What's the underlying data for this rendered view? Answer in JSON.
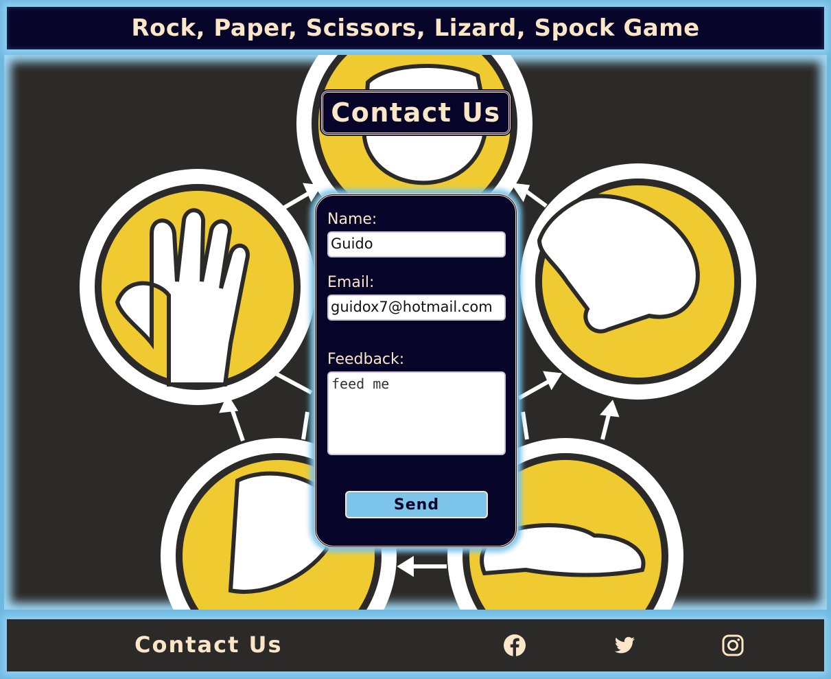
{
  "header": {
    "title": "Rock, Paper, Scissors, Lizard, Spock Game"
  },
  "main": {
    "heading": "Contact Us",
    "form": {
      "name_label": "Name:",
      "name_value": "Guido",
      "email_label": "Email:",
      "email_value": "guidox7@hotmail.com",
      "feedback_label": "Feedback:",
      "feedback_value": "feed me",
      "send_label": "Send"
    }
  },
  "footer": {
    "link": "Contact Us",
    "social": [
      {
        "icon": "facebook-icon"
      },
      {
        "icon": "twitter-icon"
      },
      {
        "icon": "instagram-icon"
      }
    ]
  },
  "colors": {
    "navy": "#07042a",
    "cream": "#fbe6c8",
    "sky": "#7cc4ea",
    "yellow": "#efcb31",
    "charcoal": "#2b2a28"
  }
}
